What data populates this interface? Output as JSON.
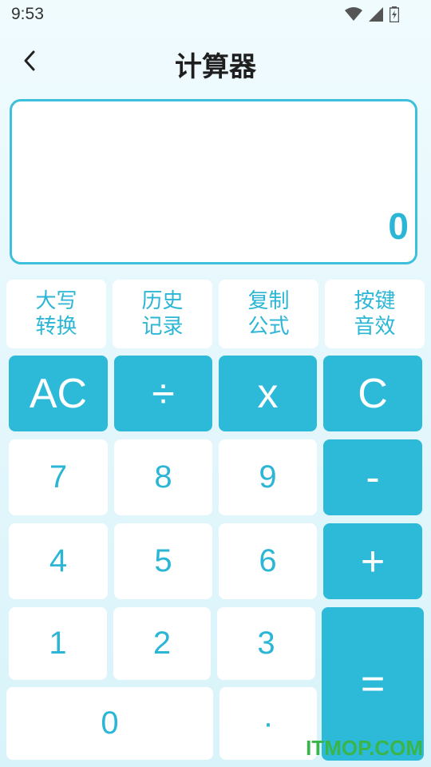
{
  "status": {
    "time": "9:53"
  },
  "header": {
    "title": "计算器"
  },
  "display": {
    "value": "0"
  },
  "functions": [
    {
      "label": "大写\n转换"
    },
    {
      "label": "历史\n记录"
    },
    {
      "label": "复制\n公式"
    },
    {
      "label": "按键\n音效"
    }
  ],
  "keys": {
    "ac": "AC",
    "divide": "÷",
    "multiply": "x",
    "clear": "C",
    "seven": "7",
    "eight": "8",
    "nine": "9",
    "minus": "-",
    "four": "4",
    "five": "5",
    "six": "6",
    "plus": "+",
    "one": "1",
    "two": "2",
    "three": "3",
    "equals": "=",
    "zero": "0",
    "dot": "·"
  },
  "watermark": "ITMOP.COM",
  "colors": {
    "accent": "#2dbad8",
    "text_accent": "#2cb6d6",
    "watermark": "#39b54a"
  }
}
